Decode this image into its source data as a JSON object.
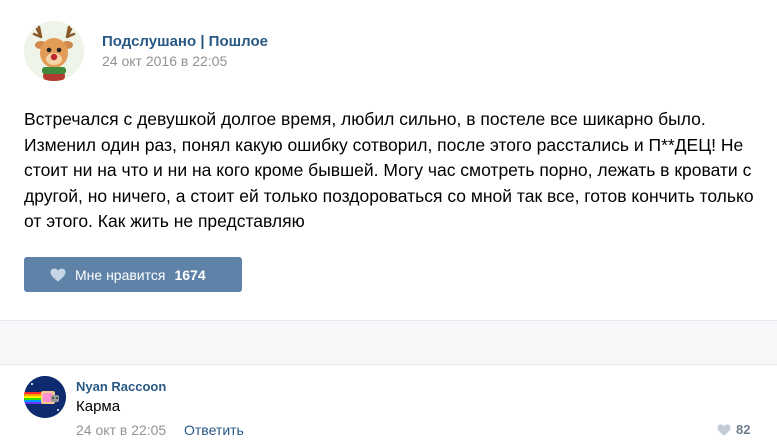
{
  "post": {
    "author": "Подслушано | Пошлое",
    "date": "24 окт 2016 в 22:05",
    "text": "Встречался с девушкой долгое время, любил сильно, в постеле все шикарно было. Изменил один раз, понял какую ошибку сотворил, после этого расстались и П**ДЕЦ! Не стоит ни на что и ни на кого кроме бывшей. Могу час смотреть порно, лежать в кровати с другой, но ничего, а стоит ей только поздороваться со мной так все, готов кончить только от этого. Как жить не представляю",
    "like_label": "Мне нравится",
    "like_count": "1674",
    "avatar_icon": "deer-avatar-icon"
  },
  "comment": {
    "author": "Nyan Raccoon",
    "text": "Карма",
    "date": "24 окт в 22:05",
    "reply_label": "Ответить",
    "like_count": "82",
    "avatar_icon": "nyan-cat-avatar-icon"
  },
  "colors": {
    "link": "#2a5885",
    "like_button": "#5e82a8",
    "muted": "#939393"
  }
}
